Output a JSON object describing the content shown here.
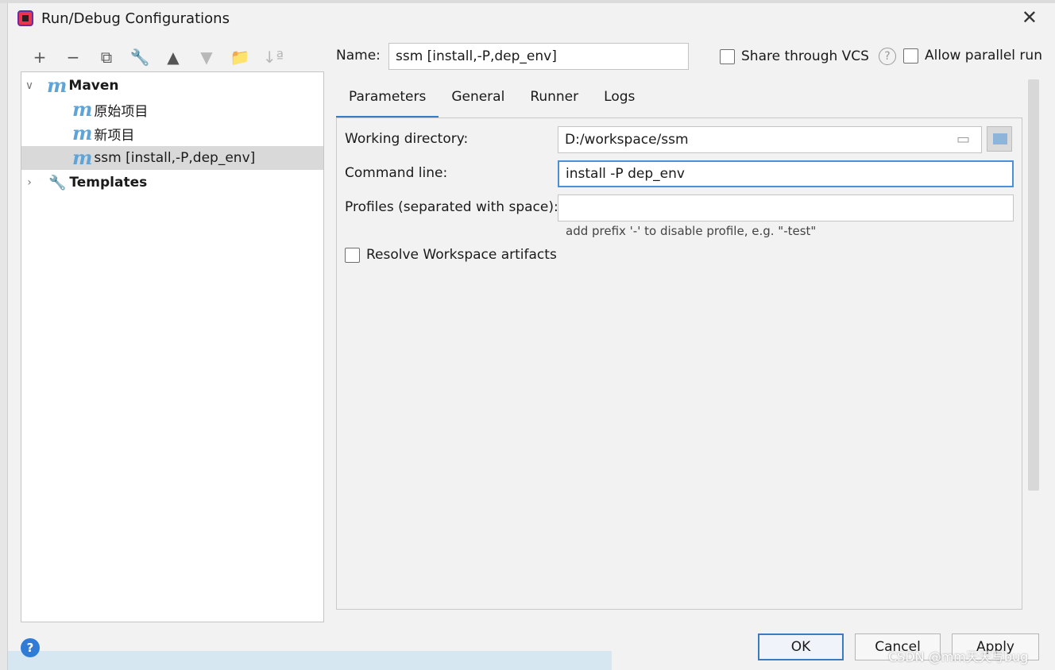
{
  "window": {
    "title": "Run/Debug Configurations"
  },
  "toolbar": {
    "add": "+",
    "remove": "−",
    "copy": "⧉",
    "edit": "🔧",
    "up": "▲",
    "down": "▼",
    "folder": "📁",
    "sort": "↓ª"
  },
  "tree": {
    "maven_label": "Maven",
    "children": [
      "原始项目",
      "新项目",
      "ssm [install,-P,dep_env]"
    ],
    "templates_label": "Templates"
  },
  "header": {
    "name_label": "Name:",
    "name_value": "ssm [install,-P,dep_env]",
    "share_label": "Share through VCS",
    "help_glyph": "?",
    "parallel_label": "Allow parallel run"
  },
  "tabs": [
    "Parameters",
    "General",
    "Runner",
    "Logs"
  ],
  "form": {
    "working_dir_label": "Working directory:",
    "working_dir_value": "D:/workspace/ssm",
    "command_label": "Command line:",
    "command_value": "install -P dep_env",
    "profiles_label": "Profiles (separated with space):",
    "profiles_value": "",
    "hint": "add prefix '-' to disable profile, e.g. \"-test\"",
    "resolve_label": "Resolve Workspace artifacts"
  },
  "buttons": {
    "ok": "OK",
    "cancel": "Cancel",
    "apply": "Apply",
    "help": "?"
  },
  "watermark": "CSDN @mm天天写bug",
  "colors": {
    "accent": "#3a7cc3",
    "maven_icon": "#5fa4d6"
  }
}
